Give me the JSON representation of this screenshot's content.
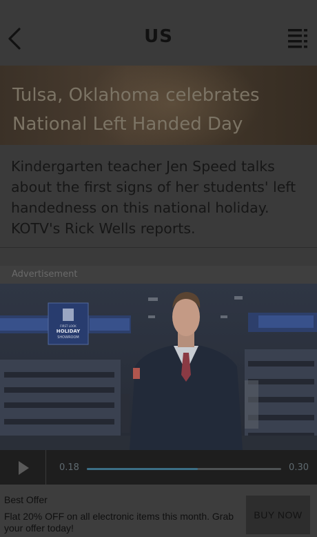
{
  "header": {
    "title": "US",
    "back_icon": "chevron-left-icon",
    "menu_icon": "list-menu-icon"
  },
  "article": {
    "headline": "Tulsa, Oklahoma celebrates National Left Handed Day",
    "description": "Kindergarten teacher Jen Speed talks about the first signs of her students' left handedness on this national holiday. KOTV's Rick Wells reports."
  },
  "ad": {
    "label": "Advertisement",
    "sign_text": [
      "FIRST LOOK",
      "HOLIDAY",
      "SHOWROOM"
    ],
    "video": {
      "current_time": "0.18",
      "total_time": "0.30",
      "progress": 0.57
    }
  },
  "offer": {
    "title": "Best Offer",
    "text": "Flat 20% OFF on all electronic items this month. Grab your offer today!",
    "button_label": "BUY NOW"
  },
  "colors": {
    "background": "#3a3a3a",
    "progress": "#3c6f86",
    "controls_bg": "#1e1e1e"
  }
}
